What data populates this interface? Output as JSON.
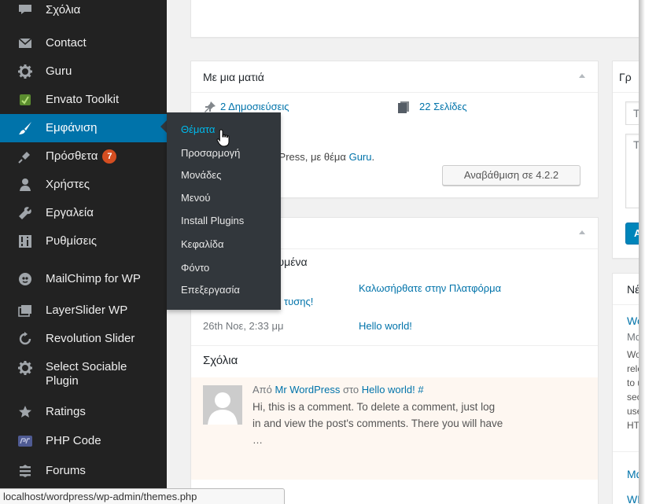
{
  "sidebar": {
    "items": [
      {
        "label": "Σχόλια",
        "icon": "comment-icon"
      },
      {
        "label": "Contact",
        "icon": "envelope-icon"
      },
      {
        "label": "Guru",
        "icon": "gear-icon"
      },
      {
        "label": "Envato Toolkit",
        "icon": "envato-icon"
      },
      {
        "label": "Εμφάνιση",
        "icon": "paintbrush-icon"
      },
      {
        "label": "Πρόσθετα",
        "icon": "plug-icon",
        "badge": "7"
      },
      {
        "label": "Χρήστες",
        "icon": "users-icon"
      },
      {
        "label": "Εργαλεία",
        "icon": "wrench-icon"
      },
      {
        "label": "Ρυθμίσεις",
        "icon": "settings-icon"
      },
      {
        "label": "MailChimp for WP",
        "icon": "mailchimp-icon"
      },
      {
        "label": "LayerSlider WP",
        "icon": "layers-icon"
      },
      {
        "label": "Revolution Slider",
        "icon": "refresh-icon"
      },
      {
        "label": "Select Sociable Plugin",
        "icon": "gear-icon"
      },
      {
        "label": "Ratings",
        "icon": "star-icon"
      },
      {
        "label": "PHP Code",
        "icon": "php-icon"
      },
      {
        "label": "Forums",
        "icon": "forums-icon"
      }
    ]
  },
  "flyout": {
    "items": [
      "Θέματα",
      "Προσαρμογή",
      "Μονάδες",
      "Μενού",
      "Install Plugins",
      "Κεφαλίδα",
      "Φόντο",
      "Επεξεργασία"
    ]
  },
  "glance": {
    "title": "Με μια ματιά",
    "posts": "2 Δημοσιεύσεις",
    "pages": "22 Σελίδες",
    "wp_prefix": "rdPress, με θέμα",
    "wp_theme": "Guru",
    "wp_suffix": ".",
    "update_button": "Αναβάθμιση σε 4.2.2"
  },
  "activity": {
    "published_heading": "τυμένα",
    "post1_title": "Καλωσήρθατε στην Πλατφόρμα",
    "post1_cont": "τυσης!",
    "post2_date": "26th Νοε, 2:33 μμ",
    "post2_title": "Hello world!",
    "comments_heading": "Σχόλια",
    "comment": {
      "from": "Από",
      "author": "Mr WordPress",
      "on": "στο",
      "post": "Hello world! #",
      "line1": "Hi, this is a comment. To delete a comment, just log",
      "line2": "in and view the post's comments. There you will have",
      "line3": "…"
    }
  },
  "quickdraft": {
    "title": "Γρ",
    "title_placeholder": "Τί",
    "content_placeholder": "Τι",
    "button": "Α"
  },
  "news": {
    "title": "Νέ",
    "link1": "Wo",
    "meta1": "Μα",
    "body": [
      "Wo",
      "rele",
      "to u",
      "sec",
      "use",
      "HTI"
    ],
    "link2": "Μα",
    "link3": "WP"
  },
  "statusbar": {
    "url": "localhost/wordpress/wp-admin/themes.php"
  },
  "colors": {
    "sidebar": "#222222",
    "active": "#0073aa",
    "flyout": "#32373c",
    "link": "#0073aa",
    "badge": "#d54e21"
  }
}
